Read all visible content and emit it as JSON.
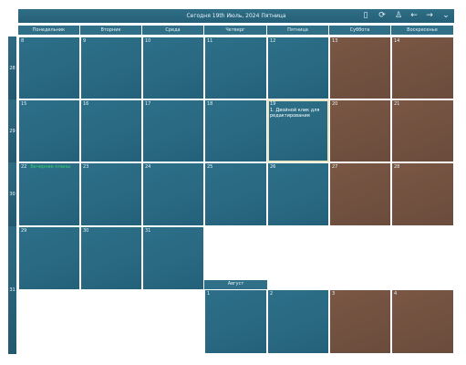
{
  "header": {
    "title": "Сегодня 19th Июль, 2024 Пятница",
    "icons": [
      "phone-icon",
      "sync-icon",
      "user-icon",
      "arrow-left-icon",
      "arrow-right-icon",
      "chevron-down-icon"
    ]
  },
  "days": [
    "Понедельник",
    "Вторник",
    "Среда",
    "Четверг",
    "Пятница",
    "Суббота",
    "Воскресенье"
  ],
  "weeks": [
    "28",
    "29",
    "30",
    "31"
  ],
  "cells": {
    "d8": "8",
    "d9": "9",
    "d10": "10",
    "d11": "11",
    "d12": "12",
    "d13": "13",
    "d14": "14",
    "d15": "15",
    "d16": "16",
    "d17": "17",
    "d18": "18",
    "d19": "19",
    "d20": "20",
    "d21": "21",
    "d22": "22",
    "d23": "23",
    "d24": "24",
    "d25": "25",
    "d26": "26",
    "d27": "27",
    "d28": "28",
    "d29": "29",
    "d30": "30",
    "d31": "31",
    "a1": "1",
    "a2": "2",
    "a3": "3",
    "a4": "4"
  },
  "events": {
    "d19_note": "1. Двойной клик для редактирования",
    "d22_note": "Вечерние планы"
  },
  "next_month": "Август"
}
